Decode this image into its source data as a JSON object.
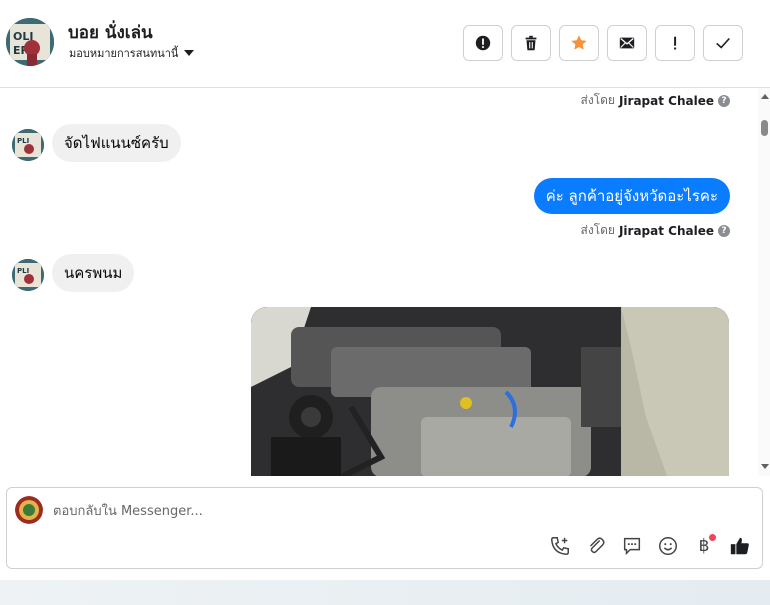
{
  "header": {
    "name": "บอย นั่งเล่น",
    "assign_label": "มอบหมายการสนทนานี้",
    "actions": [
      {
        "icon": "alert-circle-icon",
        "name": "spam-button"
      },
      {
        "icon": "trash-icon",
        "name": "delete-button"
      },
      {
        "icon": "star-icon",
        "name": "star-button"
      },
      {
        "icon": "mail-icon",
        "name": "unread-button"
      },
      {
        "icon": "exclamation-icon",
        "name": "follow-up-button"
      },
      {
        "icon": "checkmark-icon",
        "name": "done-button"
      }
    ]
  },
  "messages": {
    "sent_by_prefix": "ส่งโดย",
    "sent_by_name": "Jirapat Chalee",
    "help_mark": "?",
    "incoming_1": "จัดไฟแนนซ์ครับ",
    "outgoing_1": "ค่ะ ลูกค้าอยู่จังหวัดอะไรคะ",
    "incoming_2": "นครพนม",
    "image_alt": "engine-bay-photo"
  },
  "composer": {
    "placeholder": "ตอบกลับใน Messenger...",
    "tools": [
      "add-call-icon",
      "attachment-icon",
      "saved-replies-icon",
      "emoji-icon",
      "baht-icon",
      "like-icon"
    ],
    "baht_symbol": "฿"
  },
  "colors": {
    "accent_blue": "#0a7cff",
    "star_orange": "#f7923a",
    "incoming_bubble": "#f0f0f0",
    "notification_dot": "#f3425f"
  }
}
